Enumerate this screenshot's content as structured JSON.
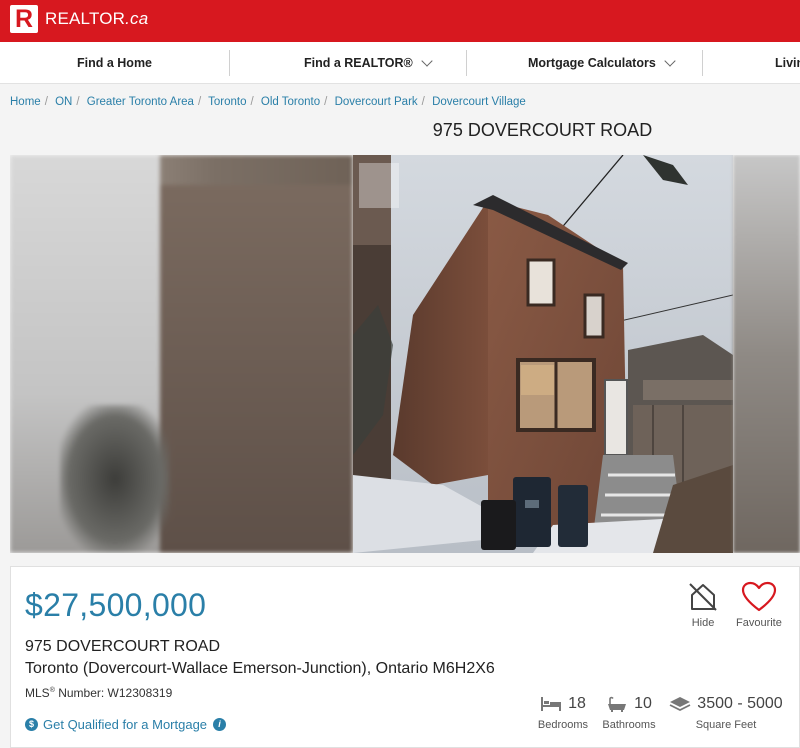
{
  "brand": {
    "logo_letter": "R",
    "name": "REALTOR",
    "suffix": ".ca"
  },
  "nav": {
    "items": [
      {
        "label": "Find a Home",
        "has_dropdown": false
      },
      {
        "label": "Find a REALTOR®",
        "has_dropdown": true
      },
      {
        "label": "Mortgage Calculators",
        "has_dropdown": true
      },
      {
        "label": "Livin",
        "has_dropdown": false
      }
    ]
  },
  "breadcrumb": [
    "Home",
    "ON",
    "Greater Toronto Area",
    "Toronto",
    "Old Toronto",
    "Dovercourt Park",
    "Dovercourt Village"
  ],
  "page_title": "975 DOVERCOURT ROAD",
  "listing": {
    "price": "$27,500,000",
    "address_line1": "975 DOVERCOURT ROAD",
    "address_line2": "Toronto (Dovercourt-Wallace Emerson-Junction), Ontario M6H2X6",
    "mls_label": "MLS",
    "mls_reg": "®",
    "mls_suffix": " Number: W12308319",
    "mortgage_link": "Get Qualified for a Mortgage",
    "actions": {
      "hide": "Hide",
      "favourite": "Favourite"
    },
    "stats": {
      "bedrooms": {
        "value": "18",
        "label": "Bedrooms"
      },
      "bathrooms": {
        "value": "10",
        "label": "Bathrooms"
      },
      "area": {
        "value": "3500 - 5000",
        "label": "Square Feet"
      }
    }
  },
  "colors": {
    "brand_red": "#d7181f",
    "link_blue": "#2a7fa8",
    "favourite_red": "#d7181f"
  }
}
